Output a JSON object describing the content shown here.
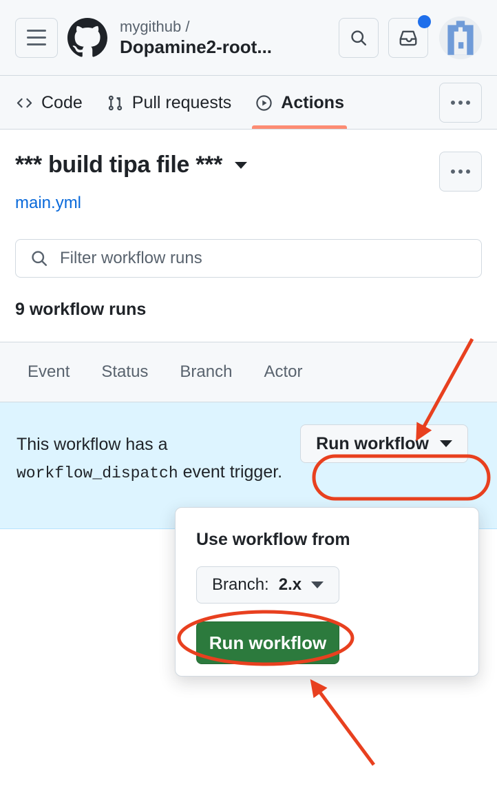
{
  "header": {
    "menu_label": "Menu",
    "logo_name": "github-logo",
    "owner": "mygithub /",
    "repo": "Dopamine2-root...",
    "search_icon": "search-icon",
    "inbox_icon": "inbox-icon",
    "has_notification": true,
    "avatar_name": "user-avatar"
  },
  "nav": {
    "tabs": [
      {
        "label": "Code",
        "icon": "code-icon",
        "active": false
      },
      {
        "label": "Pull requests",
        "icon": "git-pull-request-icon",
        "active": false
      },
      {
        "label": "Actions",
        "icon": "play-circle-icon",
        "active": true
      }
    ],
    "more_label": "More",
    "active_underline_color": "#fd8c73"
  },
  "workflow": {
    "title": "*** build tipa file ***",
    "file_link": "main.yml",
    "more_label": "More options"
  },
  "search": {
    "placeholder": "Filter workflow runs",
    "value": "",
    "icon": "search-icon"
  },
  "runs": {
    "count_label": "9 workflow runs"
  },
  "filters": [
    {
      "label": "Event"
    },
    {
      "label": "Status"
    },
    {
      "label": "Branch"
    },
    {
      "label": "Actor"
    }
  ],
  "banner": {
    "text_before": "This workflow has a",
    "code": "workflow_dispatch",
    "text_after": "event trigger.",
    "background": "#ddf4ff",
    "run_button_label": "Run workflow"
  },
  "dispatch_panel": {
    "title": "Use workflow from",
    "branch_prefix": "Branch:",
    "branch_value": "2.x",
    "submit_label": "Run workflow",
    "submit_color": "#2c7a3d"
  },
  "annotations": {
    "color": "#e8401f",
    "items": [
      {
        "type": "arrow",
        "target": "run-workflow-dropdown-button"
      },
      {
        "type": "ellipse",
        "target": "run-workflow-dropdown-button"
      },
      {
        "type": "ellipse",
        "target": "green-run-workflow-button"
      },
      {
        "type": "arrow",
        "target": "green-run-workflow-button"
      }
    ]
  }
}
